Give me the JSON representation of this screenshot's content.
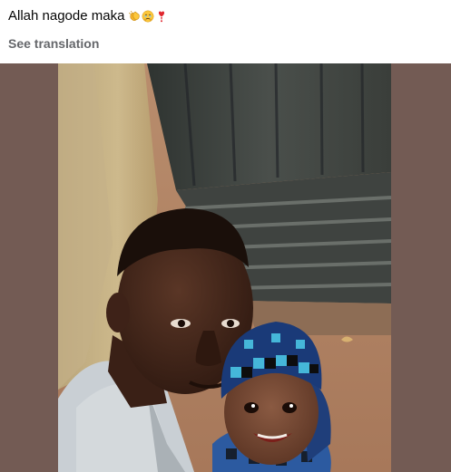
{
  "post": {
    "caption_text": "Allah nagode maka",
    "caption_emojis": [
      "clapping-hands-emoji",
      "face-holding-back-tears-emoji",
      "red-exclamation-emoji"
    ],
    "see_translation_label": "See translation"
  },
  "media": {
    "background_color": "#735b54",
    "photo_subject": "selfie-photo"
  }
}
